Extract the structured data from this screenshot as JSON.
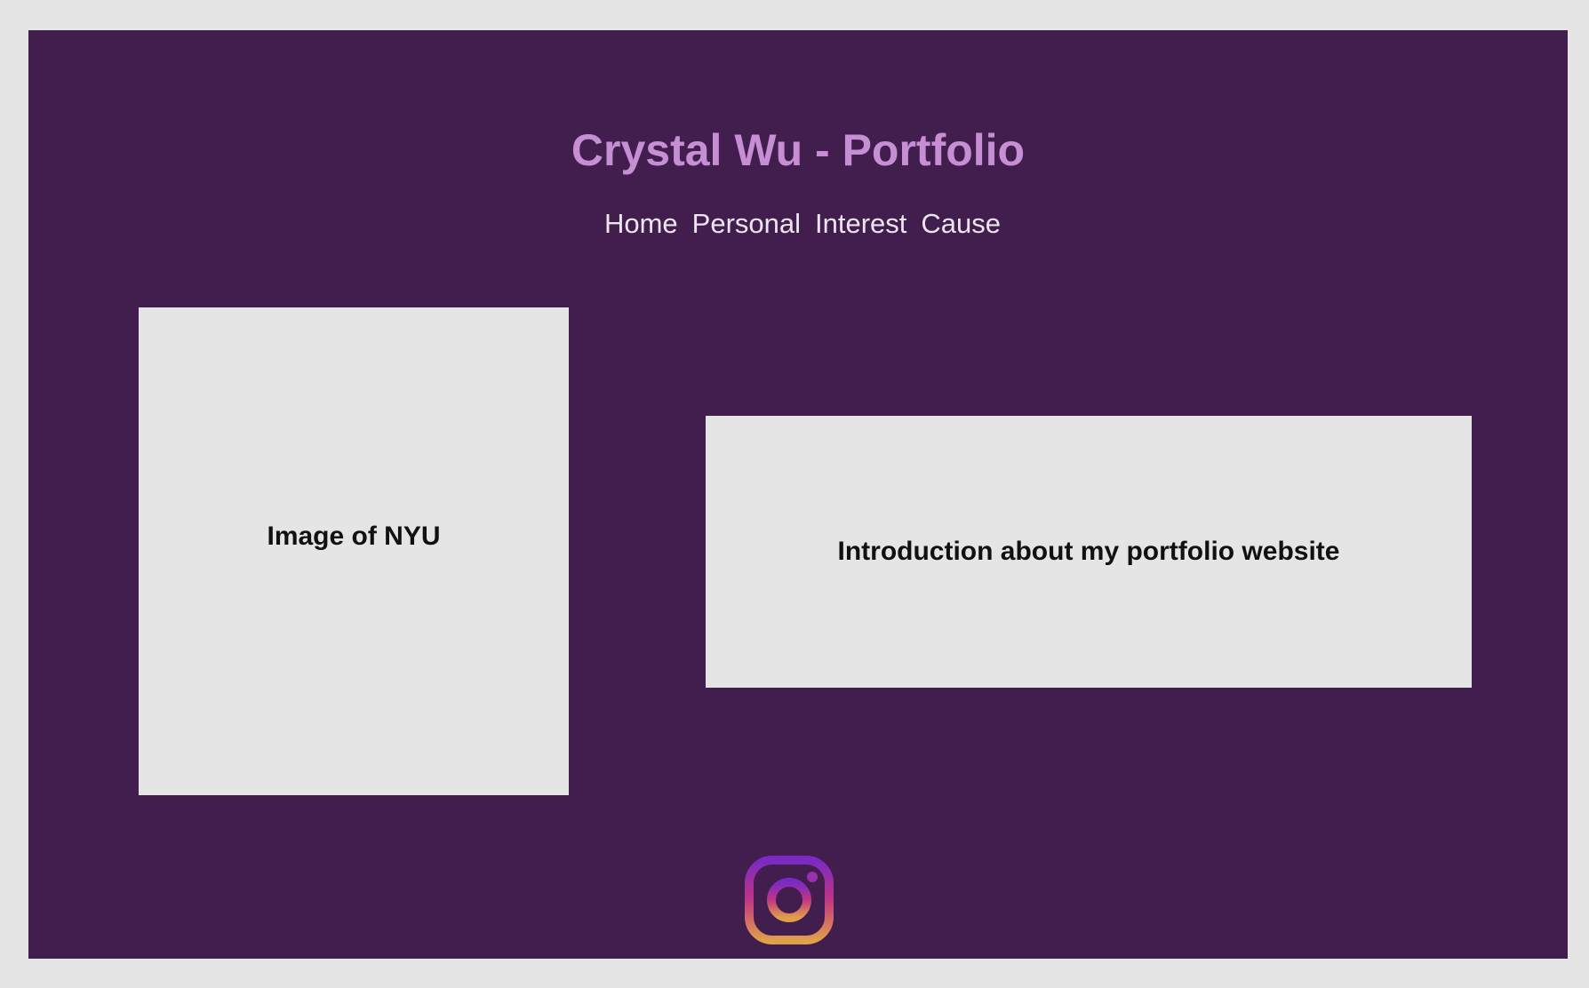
{
  "header": {
    "title": "Crystal Wu - Portfolio"
  },
  "nav": {
    "items": [
      {
        "label": "Home"
      },
      {
        "label": "Personal"
      },
      {
        "label": "Interest"
      },
      {
        "label": "Cause"
      }
    ]
  },
  "main": {
    "image_placeholder_text": "Image of NYU",
    "intro_text": "Introduction about my portfolio website"
  },
  "footer": {
    "social_icon": "instagram-icon"
  },
  "colors": {
    "page_background": "#e6e5e6",
    "frame_background": "#421e4e",
    "title_color": "#c68fd4",
    "nav_color": "#ece4ee",
    "card_background": "#e6e5e6",
    "instagram_gradient": [
      "#7a2ac4",
      "#c13584",
      "#e0a04a"
    ]
  }
}
